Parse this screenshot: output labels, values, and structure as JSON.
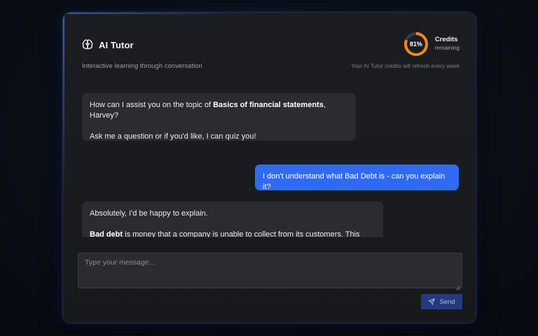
{
  "header": {
    "title": "AI Tutor",
    "subtitle": "Interactive learning through conversation",
    "brand_icon": "brain-icon"
  },
  "credits": {
    "percent_label": "81%",
    "percent_value": 0.81,
    "title": "Credits",
    "subtitle": "remaining",
    "refresh_note": "Your AI Tutor credits will refresh every week",
    "ring_color": "#f08a1c",
    "track_color": "#3a3b40"
  },
  "messages": [
    {
      "role": "ai",
      "line1_before": "How can I assist you on the topic of ",
      "line1_bold": "Basics of financial statements",
      "line1_after": ", Harvey?",
      "line2": "Ask me a question or if you'd like, I can quiz you!"
    },
    {
      "role": "user",
      "text": "I don't understand what Bad Debt is - can you explain it?"
    },
    {
      "role": "ai",
      "line1": "Absolutely, I'd be happy to explain.",
      "line2_bold": "Bad debt",
      "line2_after": " is money that a company is unable to collect from its customers. This typically happens when a customer defaults on a payment or is unable to repay the"
    }
  ],
  "composer": {
    "placeholder": "Type your message...",
    "value": "",
    "send_label": "Send",
    "send_icon": "paper-plane-icon"
  },
  "colors": {
    "accent": "#2f6bf2",
    "send_button": "#243a80",
    "bubble_ai": "#2b2c31"
  }
}
